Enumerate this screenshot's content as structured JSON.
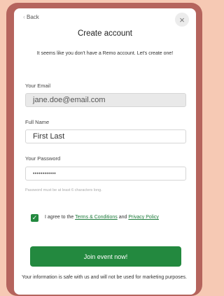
{
  "header": {
    "back_label": "Back",
    "title": "Create account",
    "subtitle": "It seems like you don't have a Remo account. Let's create one!"
  },
  "form": {
    "email_label": "Your Email",
    "email_value": "jane.doe@email.com",
    "name_label": "Full Name",
    "name_value": "First Last",
    "password_label": "Your Password",
    "password_value": "••••••••••••",
    "password_hint": "Password must be at least 6 characters long."
  },
  "consent": {
    "checked": true,
    "text_before": "I agree to the ",
    "terms_link": "Terms & Conditions",
    "text_between": " and ",
    "privacy_link": "Privacy Policy"
  },
  "cta": {
    "join_label": "Join event now!"
  },
  "footer": {
    "text": "Your information is safe with us and will not be used for marketing purposes."
  },
  "colors": {
    "accent": "#23893f",
    "background": "#f6c9b4",
    "frame": "#b5645d"
  },
  "icons": {
    "back": "chevron-left-icon",
    "close": "close-icon",
    "check": "checkmark-icon"
  }
}
